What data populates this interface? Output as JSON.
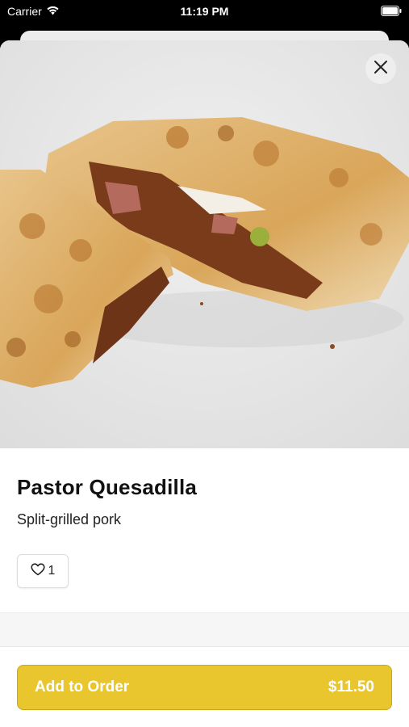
{
  "status_bar": {
    "carrier": "Carrier",
    "time": "11:19 PM"
  },
  "item": {
    "title": "Pastor Quesadilla",
    "description": "Split-grilled pork",
    "like_count": "1"
  },
  "footer": {
    "add_label": "Add to Order",
    "price": "$11.50"
  },
  "colors": {
    "accent": "#e9c52e"
  },
  "icons": {
    "close": "close-icon",
    "like": "heart-icon",
    "wifi": "wifi-icon",
    "battery": "battery-icon"
  }
}
